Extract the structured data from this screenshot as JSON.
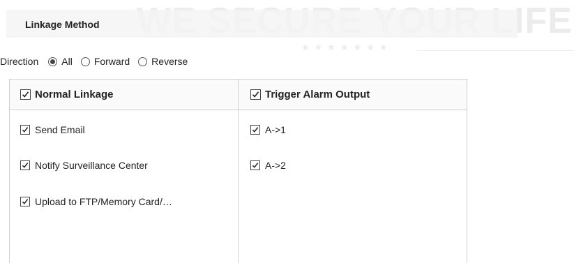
{
  "watermark": {
    "text": "WE SECURE YOUR LIFE",
    "stars": "★★★★★★★"
  },
  "section": {
    "title": "Linkage Method"
  },
  "direction": {
    "label": "Direction",
    "selected": "All",
    "options": [
      {
        "label": "All",
        "checked": true
      },
      {
        "label": "Forward",
        "checked": false
      },
      {
        "label": "Reverse",
        "checked": false
      }
    ]
  },
  "normal_linkage": {
    "header": "Normal Linkage",
    "header_checked": true,
    "items": [
      {
        "label": "Send Email",
        "checked": true
      },
      {
        "label": "Notify Surveillance Center",
        "checked": true
      },
      {
        "label": "Upload to FTP/Memory Card/…",
        "checked": true
      }
    ]
  },
  "trigger_alarm_output": {
    "header": "Trigger Alarm Output",
    "header_checked": true,
    "items": [
      {
        "label": "A->1",
        "checked": true
      },
      {
        "label": "A->2",
        "checked": true
      }
    ]
  }
}
